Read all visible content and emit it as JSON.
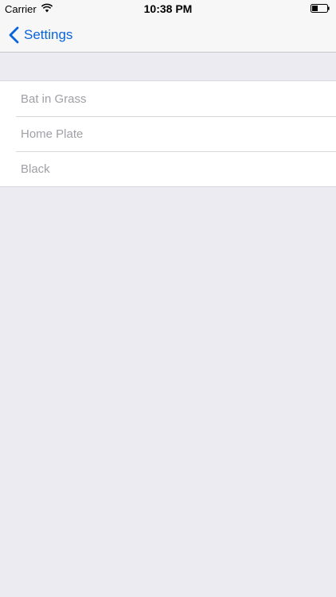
{
  "status_bar": {
    "carrier": "Carrier",
    "time": "10:38 PM",
    "wifi_icon": "wifi-icon",
    "battery_icon": "battery-icon"
  },
  "nav": {
    "back_label": "Settings",
    "back_icon": "chevron-left-icon",
    "accent_color": "#0a64d9"
  },
  "list": {
    "items": [
      {
        "label": "Bat in Grass"
      },
      {
        "label": "Home Plate"
      },
      {
        "label": "Black"
      }
    ]
  },
  "colors": {
    "background": "#ebebf1",
    "row_text": "#a0a0a6"
  }
}
